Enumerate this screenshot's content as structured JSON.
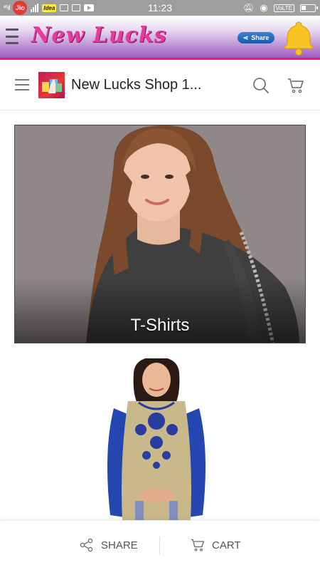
{
  "status_bar": {
    "carrier_badge": "Jio",
    "idea_badge": "Idea",
    "time": "11:23",
    "volte": "VoLTE"
  },
  "app_header": {
    "logo_text": "New Lucks",
    "share_label": "Share",
    "colors": {
      "header": "#a05cc0",
      "accent": "#e91e63",
      "logo": "#e8399e"
    }
  },
  "shop_bar": {
    "title": "New Lucks Shop 1..."
  },
  "categories": [
    {
      "label": "T-Shirts",
      "image": "woman in grey long-sleeve top"
    },
    {
      "label": "",
      "image": "woman in beige kurti with blue embroidery and blue sleeves"
    }
  ],
  "bottom_bar": {
    "share_label": "SHARE",
    "cart_label": "CART"
  }
}
